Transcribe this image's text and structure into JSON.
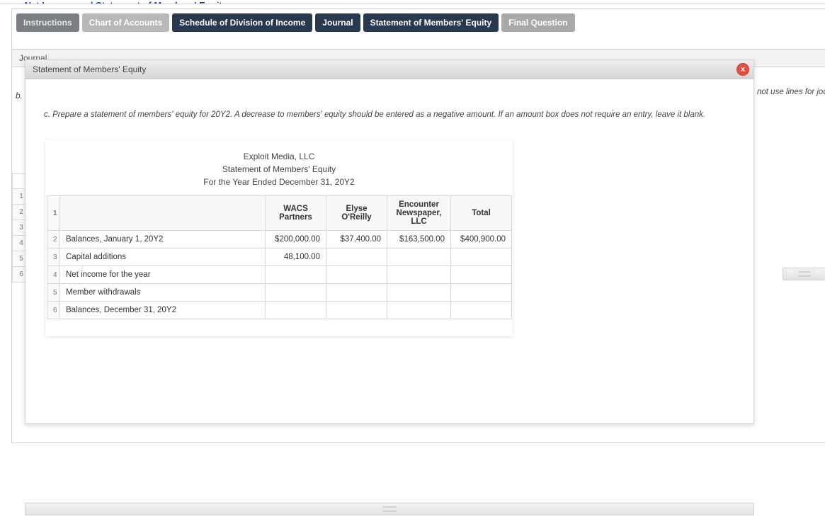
{
  "header_link_fragment": "… Net Income and Statement of Members' Equity",
  "tabs": [
    {
      "label": "Instructions",
      "style": "inactive"
    },
    {
      "label": "Chart of Accounts",
      "style": "light"
    },
    {
      "label": "Schedule of Division of Income",
      "style": "dark"
    },
    {
      "label": "Journal",
      "style": "dark"
    },
    {
      "label": "Statement of Members' Equity",
      "style": "dark"
    },
    {
      "label": "Final Question",
      "style": "muted"
    }
  ],
  "panel_title": "Journal",
  "b_label": "b.",
  "right_cut_text": "not use lines for journ",
  "modal": {
    "title": "Statement of Members' Equity",
    "close_icon_text": "x",
    "instruction": "c. Prepare a statement of members' equity for 20Y2. A decrease to members' equity should be entered as a negative amount. If an amount box does not require an entry, leave it blank.",
    "sheet": {
      "company": "Exploit Media, LLC",
      "title": "Statement of Members' Equity",
      "period": "For the Year Ended December 31, 20Y2"
    },
    "columns": {
      "c1": "WACS Partners",
      "c2": "Elyse O'Reilly",
      "c3": "Encounter Newspaper, LLC",
      "c4": "Total"
    },
    "rows": [
      {
        "n": "1",
        "label": ""
      },
      {
        "n": "2",
        "label": "Balances, January 1, 20Y2",
        "v1": "$200,000.00",
        "v2": "$37,400.00",
        "v3": "$163,500.00",
        "v4": "$400,900.00"
      },
      {
        "n": "3",
        "label": "Capital additions",
        "v1": "48,100.00",
        "v2": "",
        "v3": "",
        "v4": ""
      },
      {
        "n": "4",
        "label": "Net income for the year",
        "v1": "",
        "v2": "",
        "v3": "",
        "v4": ""
      },
      {
        "n": "5",
        "label": "Member withdrawals",
        "v1": "",
        "v2": "",
        "v3": "",
        "v4": ""
      },
      {
        "n": "6",
        "label": "Balances, December 31, 20Y2",
        "v1": "",
        "v2": "",
        "v3": "",
        "v4": ""
      }
    ]
  },
  "gutter_rows": [
    "",
    "1",
    "2",
    "3",
    "4",
    "5",
    "6"
  ]
}
